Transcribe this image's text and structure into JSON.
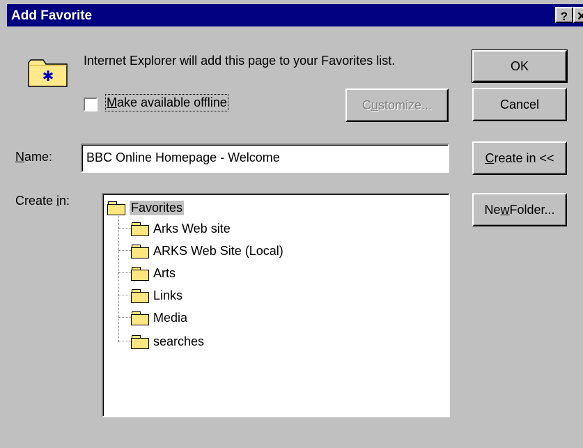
{
  "titlebar": {
    "title": "Add Favorite",
    "help_label": "?",
    "close_label": "✕"
  },
  "header": {
    "icon": "favorites-folder-icon",
    "message": "Internet Explorer will add this page to your Favorites list."
  },
  "offline": {
    "label_mnemonic": "M",
    "label_rest": "ake available offline",
    "checked": false
  },
  "buttons": {
    "customize": {
      "mnemonic": "u",
      "prefix": "C",
      "rest": "stomize..."
    },
    "ok": "OK",
    "cancel": "Cancel",
    "create_in": {
      "mnemonic": "C",
      "rest": "reate in <<"
    },
    "new_folder": {
      "prefix": "Ne",
      "mnemonic": "w",
      "rest": " Folder..."
    }
  },
  "name_field": {
    "label_mnemonic": "N",
    "label_rest": "ame:",
    "value": "BBC Online Homepage - Welcome"
  },
  "create_in_label": {
    "prefix": "Create ",
    "mnemonic": "i",
    "rest": "n:"
  },
  "tree": {
    "root": "Favorites",
    "children": [
      "Arks Web site",
      "ARKS Web Site (Local)",
      "Arts",
      "Links",
      "Media",
      "searches"
    ]
  }
}
